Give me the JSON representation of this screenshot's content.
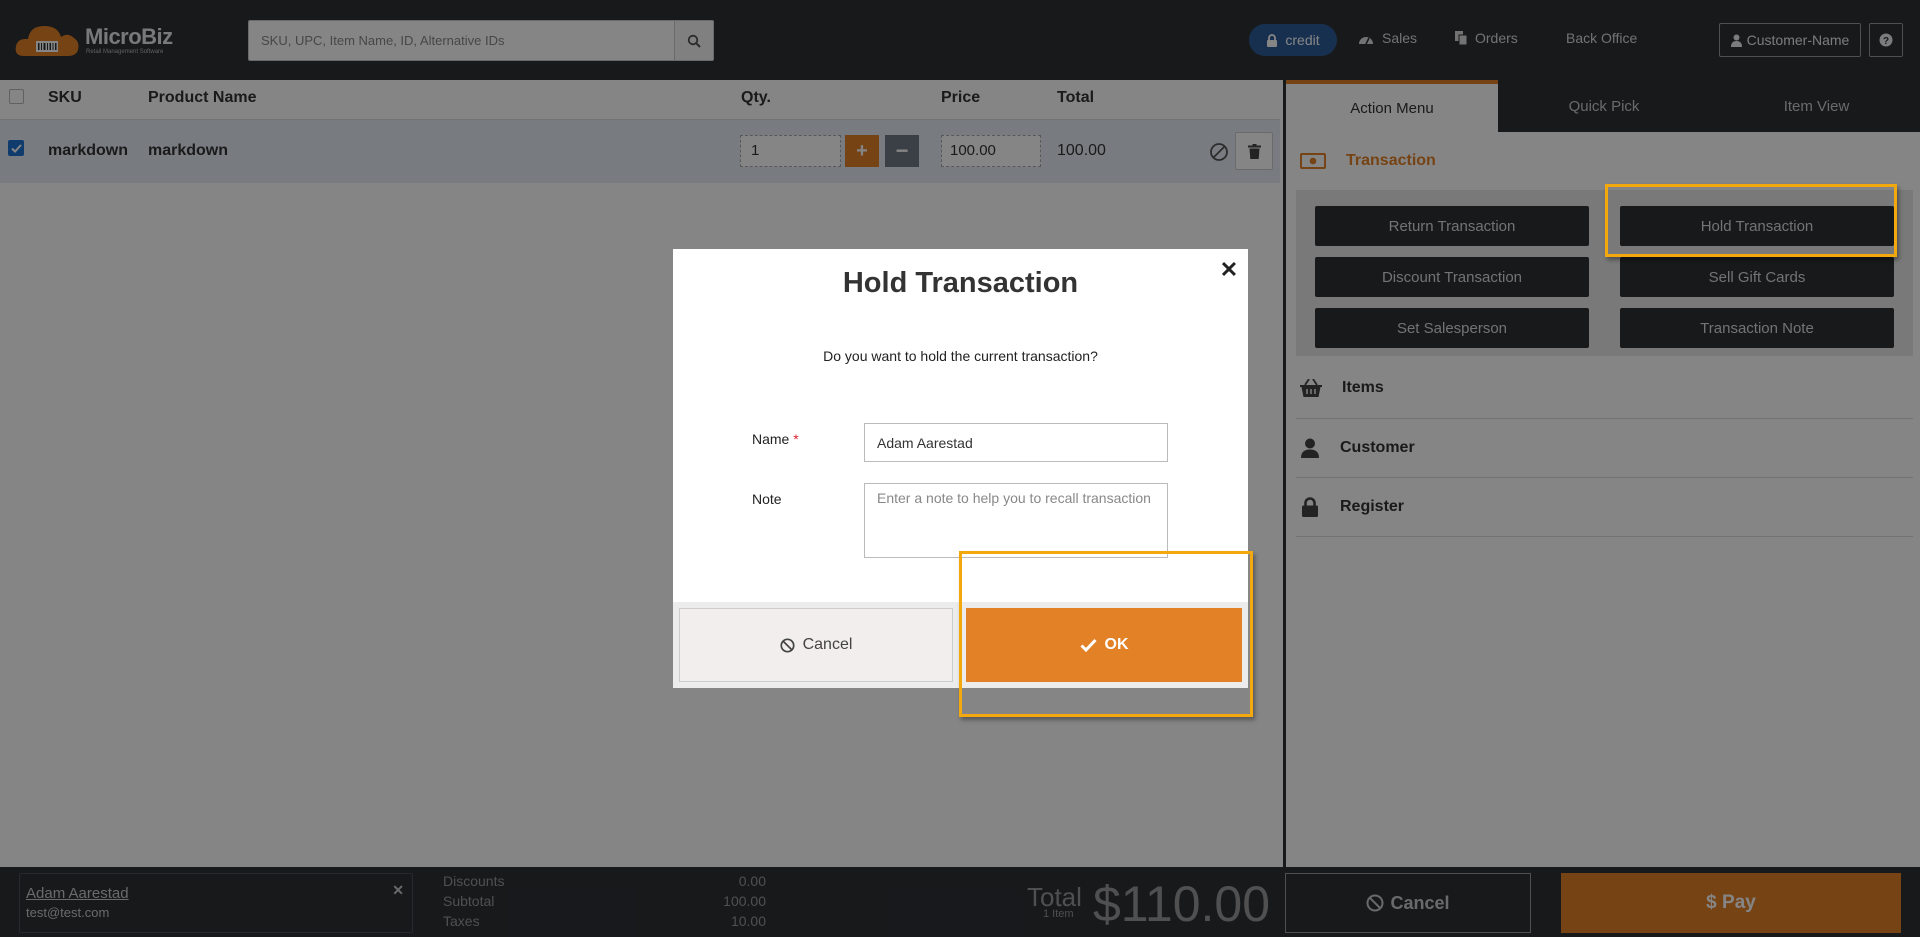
{
  "app": {
    "brand": "MicroBiz",
    "brand_sub": "Retail Management Software"
  },
  "topbar": {
    "search_placeholder": "SKU, UPC, Item Name, ID, Alternative IDs",
    "credit_label": "credit",
    "nav": [
      {
        "label": "Sales",
        "icon": "gauge-icon"
      },
      {
        "label": "Orders",
        "icon": "copy-icon"
      },
      {
        "label": "Back Office",
        "icon": ""
      }
    ],
    "customer_button": "Customer-Name"
  },
  "cart": {
    "columns": [
      "SKU",
      "Product Name",
      "Qty.",
      "Price",
      "Total"
    ],
    "rows": [
      {
        "sku": "markdown",
        "product": "markdown",
        "qty": "1",
        "price": "100.00",
        "total": "100.00",
        "checked": true
      }
    ]
  },
  "panel": {
    "tabs": [
      "Action Menu",
      "Quick Pick",
      "Item View"
    ],
    "active_tab": "Action Menu",
    "transaction_title": "Transaction",
    "actions": [
      "Return Transaction",
      "Hold Transaction",
      "Discount Transaction",
      "Sell Gift Cards",
      "Set Salesperson",
      "Transaction Note"
    ],
    "sections": [
      "Items",
      "Customer",
      "Register"
    ]
  },
  "footer": {
    "customer_name": "Adam Aarestad",
    "customer_email": "test@test.com",
    "summary": [
      {
        "label": "Discounts",
        "value": "0.00"
      },
      {
        "label": "Subtotal",
        "value": "100.00"
      },
      {
        "label": "Taxes",
        "value": "10.00"
      }
    ],
    "total_label": "Total",
    "total_items": "1 Item",
    "total_amount": "$110.00",
    "cancel_label": "Cancel",
    "pay_label": "$ Pay"
  },
  "modal": {
    "title": "Hold Transaction",
    "question": "Do you want to hold the current transaction?",
    "name_label": "Name",
    "required_mark": "*",
    "name_value": "Adam Aarestad",
    "note_label": "Note",
    "note_placeholder": "Enter a note to help you to recall transaction",
    "cancel_label": "Cancel",
    "ok_label": "OK"
  },
  "colors": {
    "accent": "#e38127",
    "dark": "#2d3035",
    "highlight": "#f4a80f",
    "credit_pill": "#2e5d9a"
  }
}
